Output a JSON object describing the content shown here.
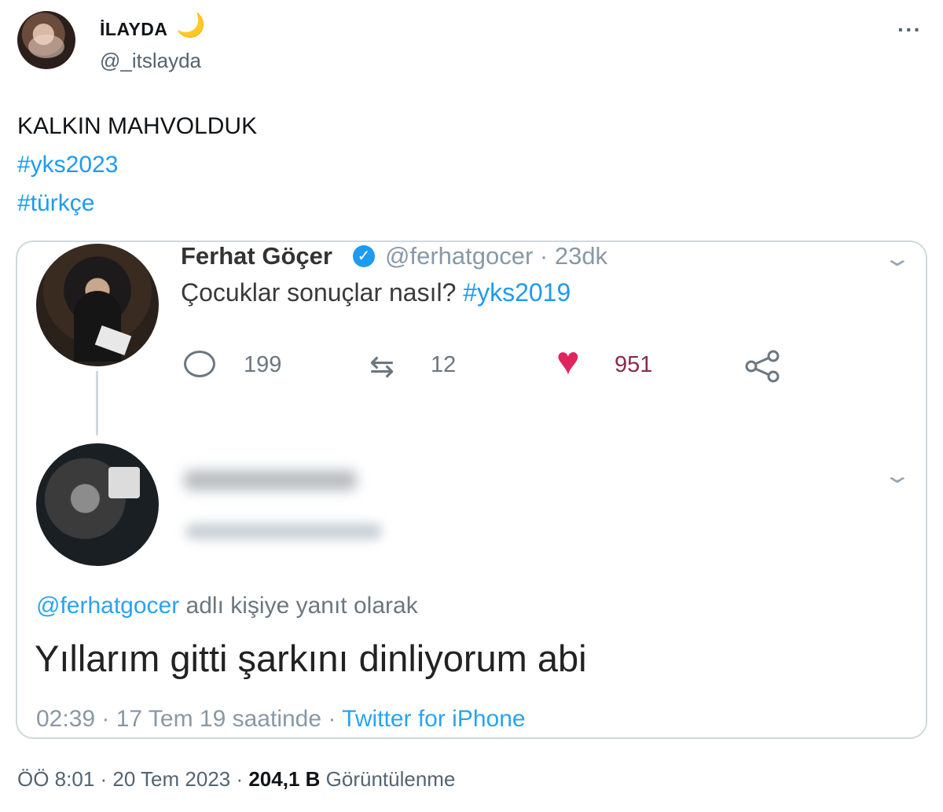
{
  "tweet": {
    "author": {
      "display_name": "İLAYDA",
      "emoji": "🌙",
      "handle": "@_itslayda"
    },
    "more_label": "···",
    "lines": [
      "KALKIN MAHVOLDUK",
      "#yks2023",
      "#türkçe"
    ],
    "footer": {
      "time_date": "ÖÖ 8:01 · 20 Tem 2023 · ",
      "views_count": "204,1 B",
      "views_label": " Görüntülenme"
    }
  },
  "quoted": {
    "author": {
      "name": "Ferhat Göçer",
      "verified_mark": "✓",
      "handle_time": "@ferhatgocer · 23dk"
    },
    "text": "Çocuklar sonuçlar nasıl? ",
    "hashtag": "#yks2019",
    "stats": {
      "replies": "199",
      "retweets": "12",
      "likes": "951"
    },
    "reply": {
      "reply_to_mention": "@ferhatgocer",
      "reply_to_rest": " adlı kişiye yanıt olarak",
      "text": "Yıllarım gitti şarkını dinliyorum abi",
      "meta_time": "02:39 · 17 Tem 19 saatinde · ",
      "meta_source": "Twitter for iPhone"
    }
  },
  "colors": {
    "accent": "#1d9bf0",
    "like": "#e0245e"
  }
}
